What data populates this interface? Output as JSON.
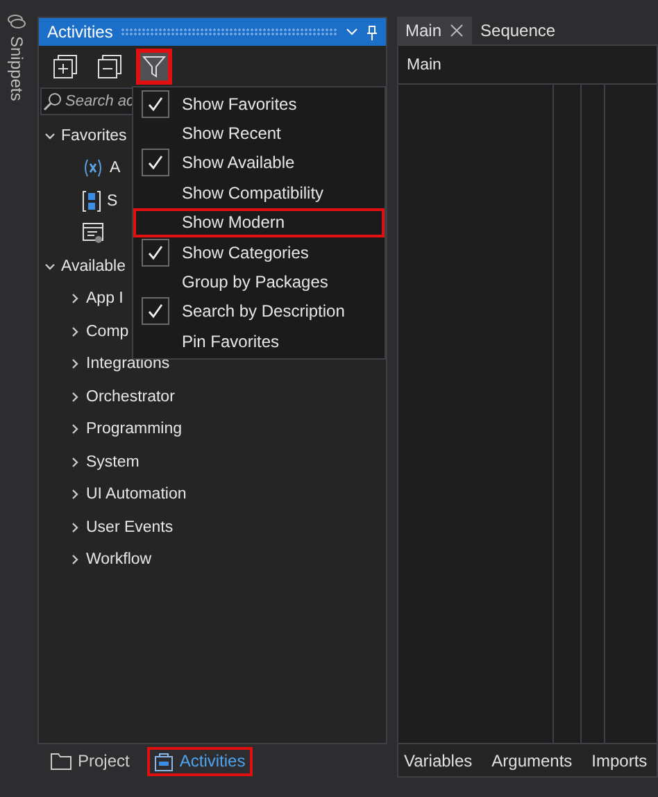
{
  "side_strip": {
    "label": "Snippets"
  },
  "activities_panel": {
    "title": "Activities",
    "toolbar": [
      {
        "kind": "expand",
        "highlighted": false
      },
      {
        "kind": "collapse",
        "highlighted": false
      },
      {
        "kind": "filter",
        "highlighted": true
      }
    ],
    "search": {
      "placeholder": "Search ac"
    },
    "tree": [
      {
        "label": "Favorites",
        "expanded": true,
        "children": [
          {
            "label": "A",
            "kind": "variable"
          },
          {
            "label": "S",
            "kind": "sequence"
          },
          {
            "kind": "window"
          }
        ]
      },
      {
        "label": "Available",
        "expanded": true,
        "children": [
          {
            "label": "App I"
          },
          {
            "label": "Comp"
          },
          {
            "label": "Integrations"
          },
          {
            "label": "Orchestrator"
          },
          {
            "label": "Programming"
          },
          {
            "label": "System"
          },
          {
            "label": "UI Automation"
          },
          {
            "label": "User Events"
          },
          {
            "label": "Workflow"
          }
        ]
      }
    ]
  },
  "filter_menu": [
    {
      "label": "Show Favorites",
      "checked": true,
      "highlighted": false
    },
    {
      "label": "Show Recent",
      "checked": false,
      "highlighted": false
    },
    {
      "label": "Show Available",
      "checked": true,
      "highlighted": false
    },
    {
      "label": "Show Compatibility",
      "checked": false,
      "highlighted": false
    },
    {
      "label": "Show Modern",
      "checked": false,
      "highlighted": true
    },
    {
      "label": "Show Categories",
      "checked": true,
      "highlighted": false
    },
    {
      "label": "Group by Packages",
      "checked": false,
      "highlighted": false
    },
    {
      "label": "Search by Description",
      "checked": true,
      "highlighted": false
    },
    {
      "label": "Pin Favorites",
      "checked": false,
      "highlighted": false
    }
  ],
  "bottom_tabs": [
    {
      "label": "Project",
      "kind": "folder",
      "selected": false,
      "highlighted": false
    },
    {
      "label": "Activities",
      "kind": "bag",
      "selected": true,
      "highlighted": true
    }
  ],
  "designer": {
    "tabs": [
      {
        "label": "Main",
        "selected": true,
        "closable": true
      },
      {
        "label": "Sequence",
        "selected": false,
        "closable": false
      }
    ],
    "breadcrumb": "Main",
    "bottom_tabs": [
      "Variables",
      "Arguments",
      "Imports"
    ]
  }
}
